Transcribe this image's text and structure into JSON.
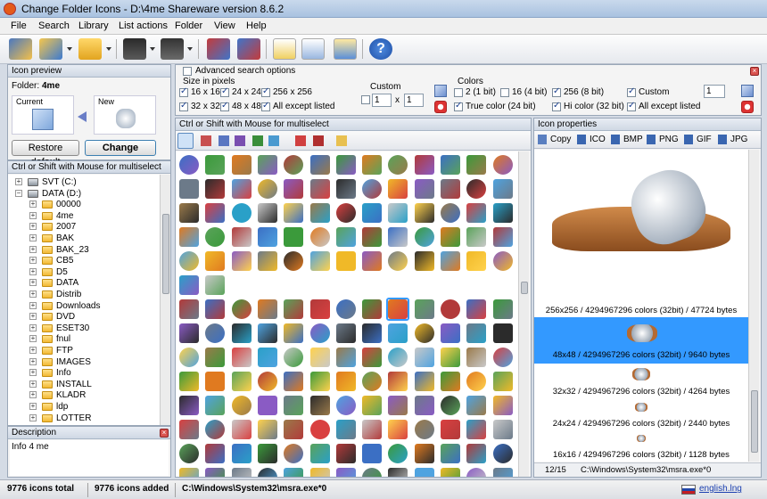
{
  "window": {
    "title": "Change Folder Icons - D:\\4me Shareware version 8.6.2"
  },
  "menu": [
    "File",
    "Search",
    "Library",
    "List actions",
    "Folder",
    "View",
    "Help"
  ],
  "icon_preview": {
    "title": "Icon preview",
    "folder_label": "Folder:",
    "folder_value": "4me",
    "current_label": "Current",
    "new_label": "New",
    "restore_button": "Restore default",
    "change_button": "Change"
  },
  "tree_panel": {
    "title": "Ctrl or Shift with Mouse for multiselect",
    "items": [
      {
        "label": "SVT (C:)",
        "type": "drive",
        "level": 1
      },
      {
        "label": "DATA (D:)",
        "type": "drive",
        "level": 1
      },
      {
        "label": "00000",
        "level": 2
      },
      {
        "label": "4me",
        "level": 2
      },
      {
        "label": "2007",
        "level": 2
      },
      {
        "label": "BAK",
        "level": 2
      },
      {
        "label": "BAK_23",
        "level": 2
      },
      {
        "label": "CB5",
        "level": 2
      },
      {
        "label": "D5",
        "level": 2
      },
      {
        "label": "DATA",
        "level": 2
      },
      {
        "label": "Distrib",
        "level": 2
      },
      {
        "label": "Downloads",
        "level": 2
      },
      {
        "label": "DVD",
        "level": 2
      },
      {
        "label": "ESET30",
        "level": 2
      },
      {
        "label": "fnul",
        "level": 2
      },
      {
        "label": "FTP",
        "level": 2
      },
      {
        "label": "IMAGES",
        "level": 2
      },
      {
        "label": "Info",
        "level": 2
      },
      {
        "label": "INSTALL",
        "level": 2
      },
      {
        "label": "KLADR",
        "level": 2
      },
      {
        "label": "ldp",
        "level": 2
      },
      {
        "label": "LOTTER",
        "level": 2
      }
    ]
  },
  "description": {
    "title": "Description",
    "text": "Info 4 me"
  },
  "search": {
    "advanced_label": "Advanced search options",
    "size_title": "Size in pixels",
    "sizes": [
      {
        "label": "16 x 16",
        "checked": true
      },
      {
        "label": "24 x 24",
        "checked": true
      },
      {
        "label": "256 x 256",
        "checked": true
      },
      {
        "label": "32 x 32",
        "checked": true
      },
      {
        "label": "48 x 48",
        "checked": true
      },
      {
        "label": "All except listed",
        "checked": true
      }
    ],
    "custom_label": "Custom",
    "custom_w": "1",
    "custom_x": "x",
    "custom_h": "1",
    "colors_title": "Colors",
    "colors": [
      {
        "label": "2 (1 bit)",
        "checked": false
      },
      {
        "label": "16 (4 bit)",
        "checked": false
      },
      {
        "label": "256 (8 bit)",
        "checked": true
      },
      {
        "label": "Custom",
        "checked": true
      },
      {
        "label": "True color (24 bit)",
        "checked": true
      },
      {
        "label": "Hi color (32 bit)",
        "checked": true
      },
      {
        "label": "All except listed",
        "checked": true
      }
    ],
    "colors_custom_value": "1"
  },
  "grid_panel": {
    "title": "Ctrl or Shift with Mouse for multiselect"
  },
  "properties": {
    "title": "Icon properties",
    "actions": [
      "Copy",
      "ICO",
      "BMP",
      "PNG",
      "GIF",
      "JPG"
    ],
    "formats": [
      {
        "label": "256x256 / 4294967296 colors (32bit) / 47724 bytes",
        "selected": false
      },
      {
        "label": "48x48 / 4294967296 colors (32bit) / 9640 bytes",
        "selected": true
      },
      {
        "label": "32x32 / 4294967296 colors (32bit) / 4264 bytes",
        "selected": false
      },
      {
        "label": "24x24 / 4294967296 colors (32bit) / 2440 bytes",
        "selected": false
      },
      {
        "label": "16x16 / 4294967296 colors (32bit) / 1128 bytes",
        "selected": false
      }
    ],
    "counter": "12/15",
    "path": "C:\\Windows\\System32\\msra.exe*0"
  },
  "status": {
    "total": "9776 icons total",
    "added": "9776 icons added",
    "path": "C:\\Windows\\System32\\msra.exe*0",
    "language": "english.lng"
  },
  "colors_theme": {
    "accent": "#3399ff",
    "selected_row": "#3399ff",
    "titlebar": "#a9c2e0"
  }
}
